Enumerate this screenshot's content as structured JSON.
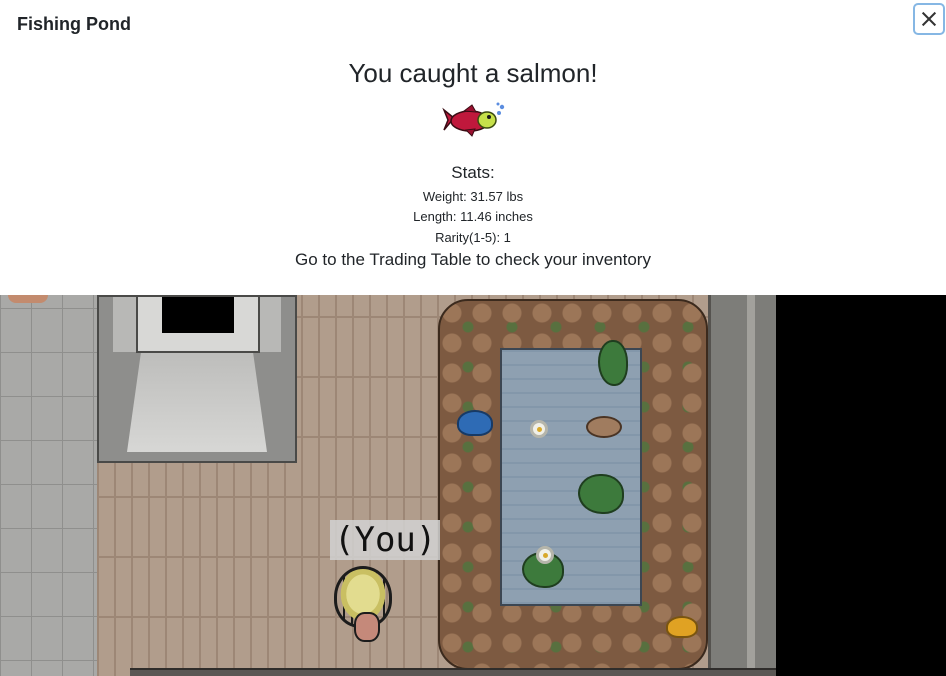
{
  "modal": {
    "title": "Fishing Pond",
    "close_label": "×",
    "heading": "You caught a salmon!",
    "fish_icon": "salmon-icon",
    "stats_heading": "Stats:",
    "stats": [
      "Weight: 31.57 lbs",
      "Length: 11.46 inches",
      "Rarity(1-5): 1"
    ],
    "footer": "Go to the Trading Table to check your inventory"
  },
  "game": {
    "player_label": "(You)"
  },
  "colors": {
    "fish_body": "#c0183c",
    "fish_head": "#c6e04a",
    "bubbles": "#5b8de0",
    "close_border": "#86b7e4"
  }
}
